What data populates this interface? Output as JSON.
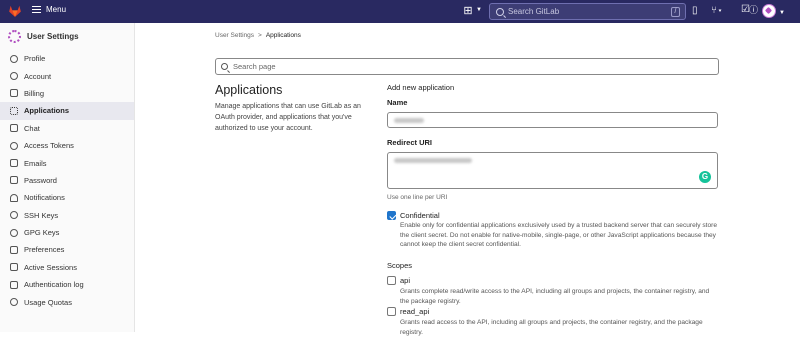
{
  "topbar": {
    "menu_label": "Menu",
    "search_placeholder": "Search GitLab",
    "search_shortcut": "/",
    "icons": [
      "gitlab-logo-icon",
      "hamburger-icon",
      "plus-square-icon",
      "chevron-down-icon",
      "search-icon",
      "issues-icon",
      "merge-request-icon",
      "todo-icon",
      "help-icon",
      "avatar"
    ]
  },
  "sidebar": {
    "title": "User Settings",
    "items": [
      {
        "label": "Profile",
        "icon": "profile-icon"
      },
      {
        "label": "Account",
        "icon": "account-icon"
      },
      {
        "label": "Billing",
        "icon": "billing-icon"
      },
      {
        "label": "Applications",
        "icon": "applications-icon",
        "active": true
      },
      {
        "label": "Chat",
        "icon": "chat-icon"
      },
      {
        "label": "Access Tokens",
        "icon": "token-icon"
      },
      {
        "label": "Emails",
        "icon": "email-icon"
      },
      {
        "label": "Password",
        "icon": "lock-icon"
      },
      {
        "label": "Notifications",
        "icon": "bell-icon"
      },
      {
        "label": "SSH Keys",
        "icon": "key-icon"
      },
      {
        "label": "GPG Keys",
        "icon": "key-icon"
      },
      {
        "label": "Preferences",
        "icon": "preferences-icon"
      },
      {
        "label": "Active Sessions",
        "icon": "sessions-icon"
      },
      {
        "label": "Authentication log",
        "icon": "log-icon"
      },
      {
        "label": "Usage Quotas",
        "icon": "quota-icon"
      }
    ]
  },
  "breadcrumb": {
    "parent": "User Settings",
    "separator": ">",
    "current": "Applications"
  },
  "search_page": {
    "placeholder": "Search page"
  },
  "page": {
    "title": "Applications",
    "description": "Manage applications that can use GitLab as an OAuth provider, and applications that you've authorized to use your account."
  },
  "form": {
    "title": "Add new application",
    "name_label": "Name",
    "redirect_label": "Redirect URI",
    "redirect_help": "Use one line per URI",
    "confidential_label": "Confidential",
    "confidential_checked": true,
    "confidential_desc": "Enable only for confidential applications exclusively used by a trusted backend server that can securely store the client secret. Do not enable for native-mobile, single-page, or other JavaScript applications because they cannot keep the client secret confidential.",
    "scopes_label": "Scopes",
    "scopes": [
      {
        "name": "api",
        "checked": false,
        "desc": "Grants complete read/write access to the API, including all groups and projects, the container registry, and the package registry."
      },
      {
        "name": "read_api",
        "checked": false,
        "desc": "Grants read access to the API, including all groups and projects, the container registry, and the package registry."
      }
    ]
  },
  "colors": {
    "topbar": "#292961",
    "accent": "#1f75cb",
    "grammarly": "#15c39a"
  }
}
